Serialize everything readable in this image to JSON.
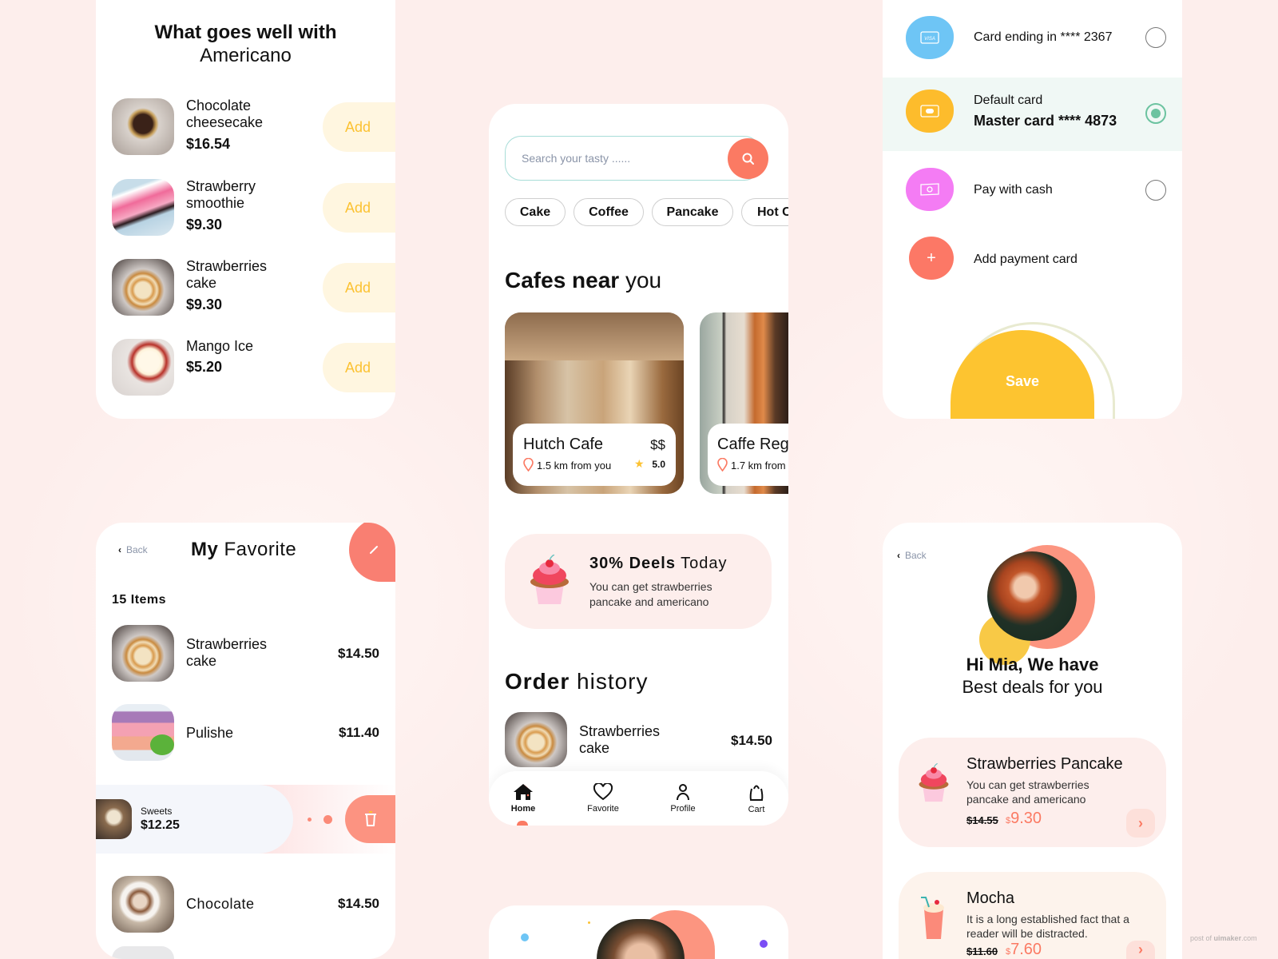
{
  "colors": {
    "background": "#fdeeec",
    "accent_coral": "#fb7a63",
    "accent_yellow": "#fcc232",
    "selected_green": "#6cc3a0"
  },
  "pairing": {
    "title_bold": "What goes well with",
    "title_regular": "Americano",
    "add_label": "Add",
    "items": [
      {
        "name_line1": "Chocolate",
        "name_line2": "cheesecake",
        "price": "$16.54"
      },
      {
        "name_line1": "Strawberry",
        "name_line2": "smoothie",
        "price": "$9.30"
      },
      {
        "name_line1": "Strawberries",
        "name_line2": "cake",
        "price": "$9.30"
      },
      {
        "name_line1": "Mango Ice",
        "name_line2": "",
        "price": "$5.20"
      }
    ]
  },
  "favorite": {
    "back_label": "Back",
    "title_bold": "My",
    "title_regular": "Favorite",
    "edit_icon": "pencil-icon",
    "count": "15 Items",
    "items": [
      {
        "name_line1": "Strawberries",
        "name_line2": "cake",
        "price": "$14.50"
      },
      {
        "name_line1": "Pulishe",
        "name_line2": "",
        "price": "$11.40"
      },
      {
        "name_line1": "Chocolate",
        "name_line2": "",
        "price": "$14.50"
      }
    ],
    "swiped": {
      "category": "Sweets",
      "price": "$12.25",
      "delete_icon": "trash-icon"
    }
  },
  "home": {
    "search_placeholder": "Search your tasty ......",
    "chips": [
      "Cake",
      "Coffee",
      "Pancake",
      "Hot C"
    ],
    "cafes_title_bold": "Cafes near",
    "cafes_title_regular": "you",
    "cafes": [
      {
        "name": "Hutch Cafe",
        "price_level": "$$",
        "distance": "1.5 km from you",
        "rating": "5.0"
      },
      {
        "name": "Caffe Reg",
        "distance": "1.7 km from"
      }
    ],
    "promo": {
      "title_bold": "30% Deels",
      "title_regular": "Today",
      "line1": "You can get strawberries",
      "line2": "pancake and americano"
    },
    "order_title_bold": "Order",
    "order_title_regular": "history",
    "orders": [
      {
        "name_line1": "Strawberries",
        "name_line2": "cake",
        "price": "$14.50"
      }
    ],
    "nav": [
      {
        "label": "Home",
        "icon": "home-icon",
        "active": true
      },
      {
        "label": "Favorite",
        "icon": "heart-icon"
      },
      {
        "label": "Profile",
        "icon": "user-icon"
      },
      {
        "label": "Cart",
        "icon": "bag-icon"
      }
    ]
  },
  "payment": {
    "options": [
      {
        "label": "Card ending in **** 2367",
        "icon": "visa-card-icon",
        "selected": false
      },
      {
        "sublabel": "Default card",
        "label": "Master card **** 4873",
        "icon": "card-icon",
        "selected": true
      },
      {
        "label": "Pay with cash",
        "icon": "cash-icon",
        "selected": false
      }
    ],
    "add_label": "Add payment card",
    "save_label": "Save"
  },
  "deals": {
    "back_label": "Back",
    "greeting_bold": "Hi Mia, We have",
    "greeting_regular": "Best deals for you",
    "items": [
      {
        "title": "Strawberries Pancake",
        "line1": "You can get strawberries",
        "line2": "pancake and americano",
        "old_price": "$14.55",
        "price_currency": "$",
        "price": "9.30"
      },
      {
        "title": "Mocha",
        "line1": "It is a long established fact that a",
        "line2": "reader will be distracted.",
        "old_price": "$11.60",
        "price_currency": "$",
        "price": "7.60"
      }
    ]
  },
  "watermark": {
    "prefix": "post of",
    "brand": "uimaker",
    "suffix": ".com"
  }
}
